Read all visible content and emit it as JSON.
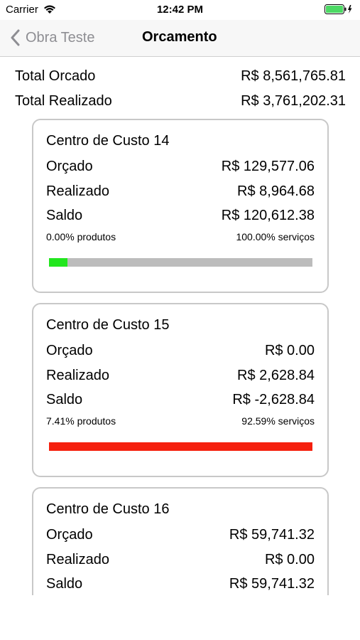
{
  "status_bar": {
    "carrier": "Carrier",
    "time": "12:42 PM"
  },
  "nav": {
    "back_label": "Obra Teste",
    "title": "Orcamento"
  },
  "totals": {
    "orcado_label": "Total Orcado",
    "orcado_value": "R$ 8,561,765.81",
    "realizado_label": "Total Realizado",
    "realizado_value": "R$ 3,761,202.31"
  },
  "cards": [
    {
      "title": "Centro de Custo 14",
      "orcado_label": "Orçado",
      "orcado_value": "R$ 129,577.06",
      "realizado_label": "Realizado",
      "realizado_value": "R$ 8,964.68",
      "saldo_label": "Saldo",
      "saldo_value": "R$ 120,612.38",
      "produtos": "0.00% produtos",
      "servicos": "100.00% serviços",
      "progress": 0.07,
      "progress_color": "#22e61e"
    },
    {
      "title": "Centro de Custo 15",
      "orcado_label": "Orçado",
      "orcado_value": "R$ 0.00",
      "realizado_label": "Realizado",
      "realizado_value": "R$ 2,628.84",
      "saldo_label": "Saldo",
      "saldo_value": "R$ -2,628.84",
      "produtos": "7.41% produtos",
      "servicos": "92.59% serviços",
      "progress": 1.0,
      "progress_color": "#f5200e"
    },
    {
      "title": "Centro de Custo 16",
      "orcado_label": "Orçado",
      "orcado_value": "R$ 59,741.32",
      "realizado_label": "Realizado",
      "realizado_value": "R$ 0.00",
      "saldo_label": "Saldo",
      "saldo_value": "R$ 59,741.32",
      "produtos": "",
      "servicos": "",
      "progress": 0,
      "progress_color": "#22e61e"
    }
  ],
  "colors": {
    "battery": "#4cd964",
    "back_tint": "#8e8e93"
  }
}
